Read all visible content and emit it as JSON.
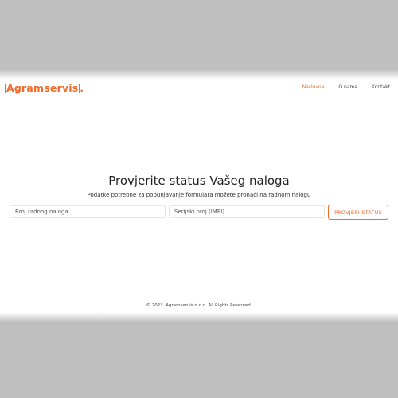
{
  "brand": {
    "name": "Agramservis",
    "dot": "."
  },
  "nav": {
    "items": [
      {
        "label": "Naslovna",
        "active": true
      },
      {
        "label": "O nama",
        "active": false
      },
      {
        "label": "Kontakt",
        "active": false
      }
    ]
  },
  "hero": {
    "title": "Provjerite status Vašeg naloga",
    "subtitle": "Podatke potrebne za popunjavanje formulara možete pronaći na radnom nalogu"
  },
  "form": {
    "order_placeholder": "Broj radnog naloga",
    "serial_placeholder": "Serijski broj (IMEI)",
    "submit_label": "PROVJERI STATUS"
  },
  "footer": {
    "text": "© 2023. Agramservis d.o.o. All Rights Reserved."
  },
  "colors": {
    "accent": "#f26b2a",
    "background": "#ffffff",
    "outer": "#bfbfbf"
  }
}
